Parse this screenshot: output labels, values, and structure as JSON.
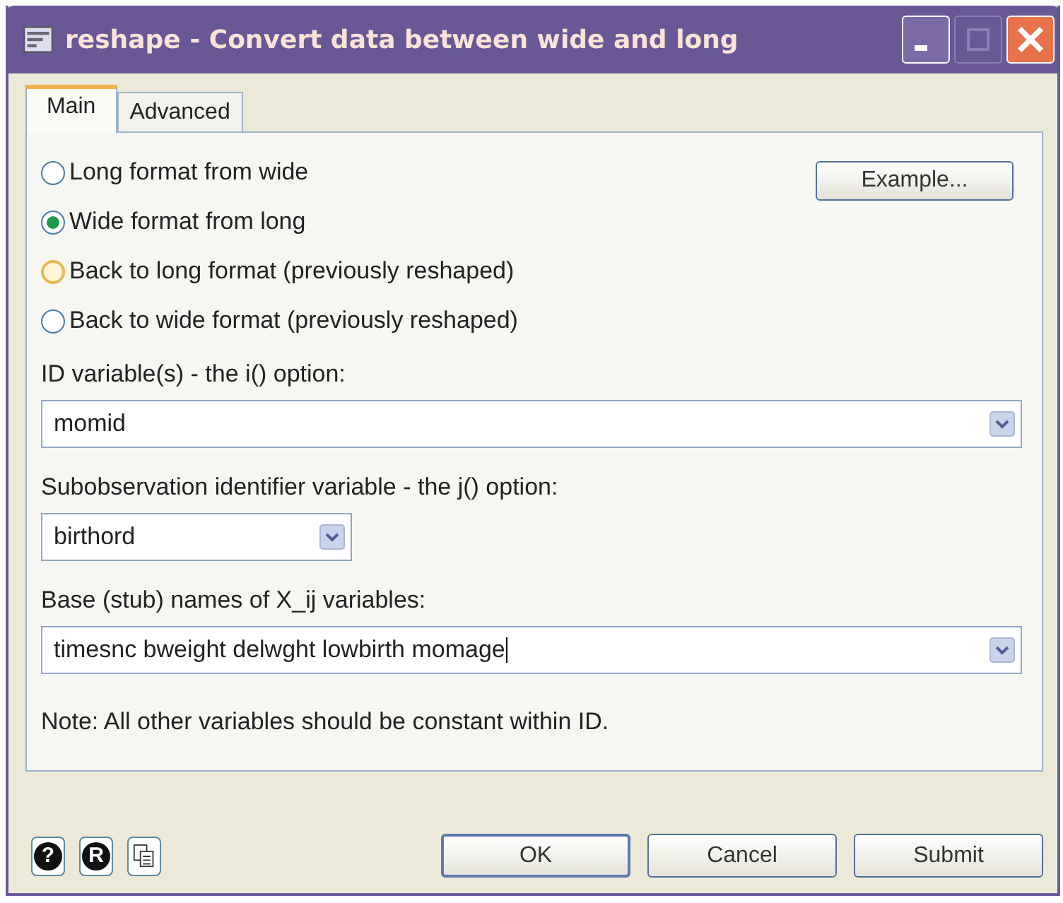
{
  "window": {
    "title": "reshape - Convert data between wide and long"
  },
  "tabs": [
    {
      "label": "Main",
      "selected": true
    },
    {
      "label": "Advanced",
      "selected": false
    }
  ],
  "formats": [
    {
      "label": "Long format from wide",
      "selected": false,
      "hovered": false
    },
    {
      "label": "Wide format from long",
      "selected": true,
      "hovered": false
    },
    {
      "label": "Back to long format (previously reshaped)",
      "selected": false,
      "hovered": true
    },
    {
      "label": "Back to wide format (previously reshaped)",
      "selected": false,
      "hovered": false
    }
  ],
  "example_button": "Example...",
  "fields": [
    {
      "label": "ID variable(s) - the i() option:",
      "value": "momid",
      "wide": true,
      "caret": false
    },
    {
      "label": "Subobservation identifier variable - the j() option:",
      "value": "birthord",
      "wide": false,
      "caret": false
    },
    {
      "label": "Base (stub) names of X_ij variables:",
      "value": "timesnc bweight delwght lowbirth momage",
      "wide": true,
      "caret": true
    }
  ],
  "note": "Note:  All other variables should be constant within ID.",
  "tool_buttons": [
    {
      "kind": "help",
      "glyph": "?"
    },
    {
      "kind": "r",
      "glyph": "R"
    },
    {
      "kind": "copy"
    }
  ],
  "buttons": [
    "OK",
    "Cancel",
    "Submit"
  ]
}
